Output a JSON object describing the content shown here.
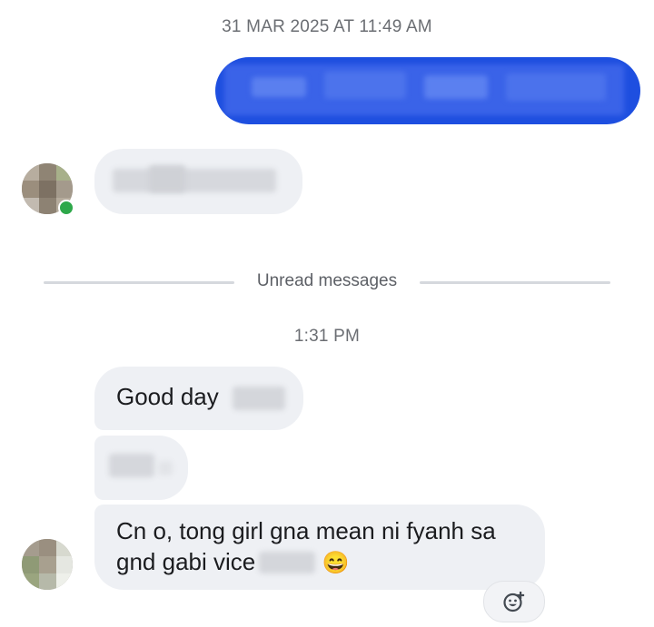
{
  "conversation": {
    "date_header": "31 MAR 2025 AT 11:49 AM",
    "unread_divider": "Unread messages",
    "time_header": "1:31 PM",
    "messages": [
      {
        "text": "Good day"
      },
      {
        "line1": "Cn o, tong girl gna mean ni fyanh sa",
        "line2": "gnd gabi vice",
        "emoji": "😄"
      }
    ]
  },
  "icons": {
    "react": "add-reaction-icon",
    "presence": "online-status-dot"
  },
  "colors": {
    "outgoing_bubble": "#1e4fe0",
    "incoming_bubble": "#eef0f4",
    "online": "#2ea84a",
    "divider": "#d5d8dd"
  }
}
